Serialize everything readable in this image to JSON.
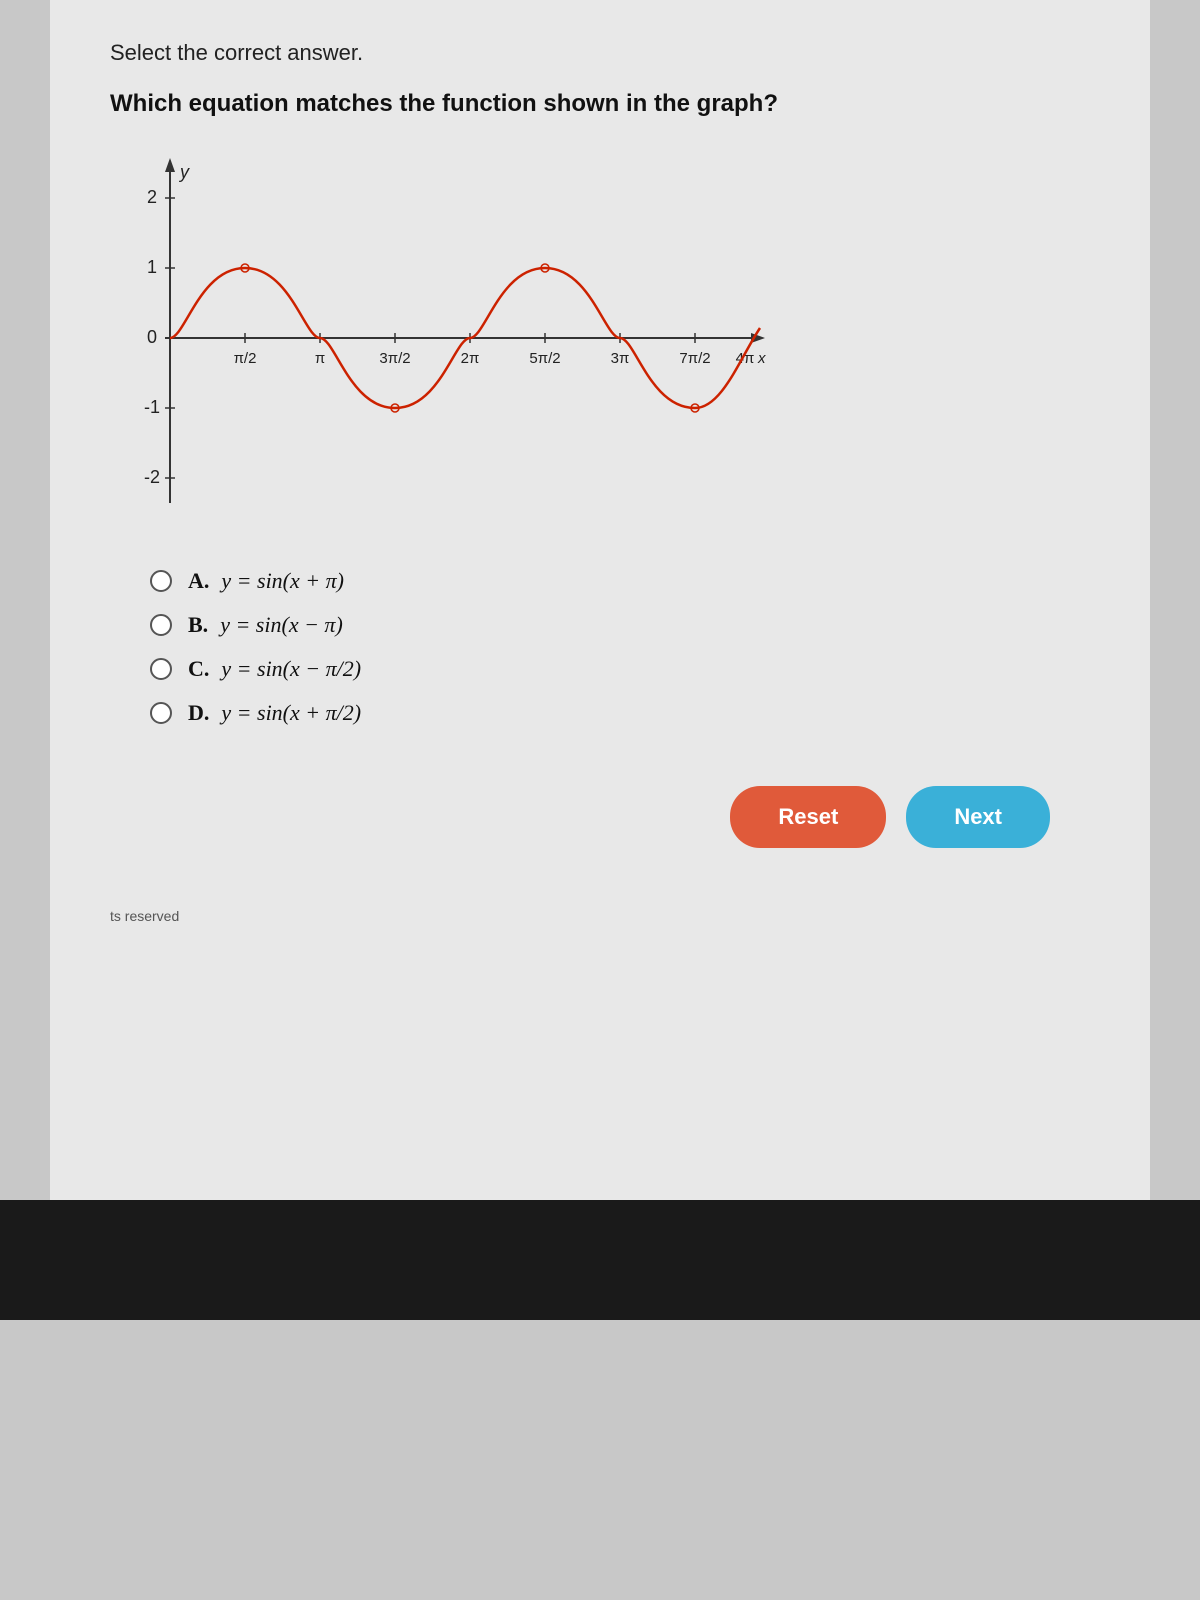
{
  "page": {
    "instruction": "Select the correct answer.",
    "question": "Which equation matches the function shown in the graph?",
    "footer": "ts reserved"
  },
  "buttons": {
    "reset_label": "Reset",
    "next_label": "Next"
  },
  "options": [
    {
      "id": "A",
      "label": "A.",
      "equation": "y = sin(x + π)",
      "html_equation": "y&thinsp;=&thinsp;sin&thinsp;(x&thinsp;+&thinsp;&pi;)"
    },
    {
      "id": "B",
      "label": "B.",
      "equation": "y = sin(x − π)",
      "html_equation": "y&thinsp;=&thinsp;sin&thinsp;(x&thinsp;&minus;&thinsp;&pi;)"
    },
    {
      "id": "C",
      "label": "C.",
      "equation": "y = sin(x − π/2)",
      "html_equation": "y&thinsp;=&thinsp;sin&thinsp;(x&thinsp;&minus;&thinsp;&pi;/2)"
    },
    {
      "id": "D",
      "label": "D.",
      "equation": "y = sin(x + π/2)",
      "html_equation": "y&thinsp;=&thinsp;sin&thinsp;(x&thinsp;+&thinsp;&pi;/2)"
    }
  ],
  "graph": {
    "y_labels": [
      "2",
      "1",
      "0",
      "-1",
      "-2"
    ],
    "x_labels": [
      "π/2",
      "π",
      "3π/2",
      "2π",
      "5π/2",
      "3π",
      "7π/2",
      "4π"
    ],
    "curve_color": "#cc2200",
    "axis_color": "#333"
  }
}
